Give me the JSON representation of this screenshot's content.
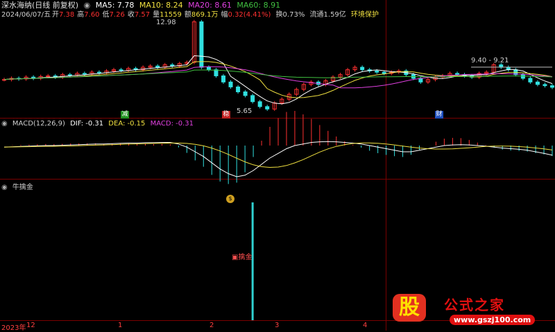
{
  "header": {
    "stock": "深水海纳(日线 前复权)",
    "date": "2024/06/07/五",
    "open_label": "开",
    "open": "7.38",
    "high_label": "高",
    "high": "7.60",
    "low_label": "低",
    "low": "7.26",
    "close_label": "收",
    "close": "7.57",
    "vol_label": "量",
    "vol": "11559",
    "amt_label": "额",
    "amt": "869.1万",
    "chg_label": "幅",
    "chg": "0.32(4.41%)",
    "turn": "换0.73%",
    "float": "流通1.59亿",
    "tag": "环境保护",
    "ma5": "MA5: 7.78",
    "ma10": "MA10: 8.24",
    "ma20": "MA20: 8.61",
    "ma60": "MA60: 8.91"
  },
  "macd_header": {
    "name": "MACD(12,26,9)",
    "dif": "DIF: -0.31",
    "dea": "DEA: -0.15",
    "macd": "MACD: -0.31"
  },
  "ind_header": {
    "name": "牛擒金"
  },
  "annotations": {
    "high_mark": "12.98",
    "low_mark": "5.65",
    "range_mark": "9.40 - 9.21",
    "marker1": "减",
    "marker2": "稳",
    "marker3": "财",
    "signal_label": "擒金",
    "signal_icon": "gold-ingot-icon"
  },
  "axis": {
    "labels": [
      "2023年",
      "12",
      "1",
      "2",
      "3",
      "4"
    ]
  },
  "watermark": {
    "badge": "股",
    "title": "公式之家",
    "url": "www.gszj100.com"
  },
  "colors": {
    "up": "#ff3030",
    "down": "#30e0e0",
    "ma5": "#ffffff",
    "ma10": "#f0e040",
    "ma20": "#e040e0",
    "ma60": "#40c040"
  },
  "chart_data": {
    "type": "candlestick",
    "ylim": [
      5.65,
      12.98
    ],
    "close_series": [
      8.2,
      8.3,
      8.25,
      8.4,
      8.3,
      8.45,
      8.5,
      8.4,
      8.6,
      8.55,
      8.7,
      8.65,
      8.8,
      8.75,
      8.9,
      9.0,
      8.95,
      9.1,
      9.0,
      9.2,
      9.3,
      9.2,
      9.4,
      9.3,
      9.5,
      9.6,
      12.9,
      9.2,
      9.0,
      8.5,
      8.0,
      7.6,
      7.2,
      6.9,
      6.4,
      6.0,
      5.8,
      6.3,
      6.6,
      7.0,
      7.4,
      7.8,
      8.0,
      7.8,
      8.1,
      8.4,
      8.6,
      9.0,
      9.2,
      9.0,
      8.9,
      8.8,
      8.7,
      8.8,
      8.9,
      8.6,
      8.3,
      8.0,
      8.2,
      8.4,
      8.5,
      8.7,
      8.6,
      8.5,
      8.4,
      8.7,
      8.8,
      9.4,
      9.2,
      9.0,
      8.6,
      8.3,
      8.0,
      7.8,
      7.7,
      7.57
    ],
    "macd_dif": [
      -0.05,
      -0.04,
      -0.03,
      -0.02,
      -0.01,
      0.0,
      0.0,
      0.01,
      0.02,
      0.03,
      0.04,
      0.05,
      0.05,
      0.06,
      0.07,
      0.08,
      0.08,
      0.09,
      0.09,
      0.1,
      0.1,
      0.05,
      -0.05,
      -0.2,
      -0.35,
      -0.55,
      -0.75,
      -0.9,
      -1.0,
      -0.95,
      -0.8,
      -0.6,
      -0.4,
      -0.25,
      -0.1,
      0.0,
      0.05,
      0.1,
      0.12,
      0.13,
      0.12,
      0.1,
      0.08,
      0.05,
      0.0,
      -0.05,
      -0.1,
      -0.15,
      -0.2,
      -0.2,
      -0.15,
      -0.1,
      -0.05,
      0.0,
      0.02,
      0.03,
      0.02,
      0.0,
      -0.02,
      -0.05,
      -0.08,
      -0.1,
      -0.12,
      -0.15,
      -0.2,
      -0.25,
      -0.31
    ],
    "signal_index": 34
  }
}
